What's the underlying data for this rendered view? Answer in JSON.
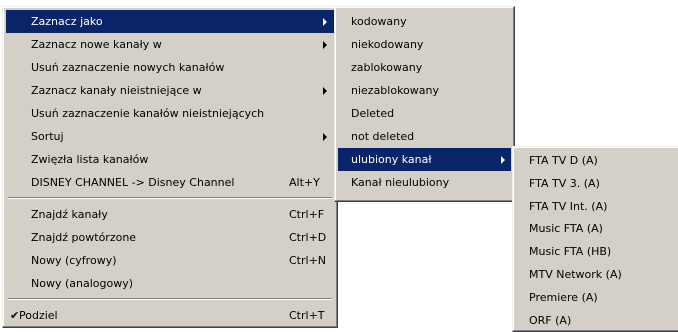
{
  "menu_main": {
    "items": [
      {
        "label": "Zaznacz jako",
        "shortcut": "",
        "submenu": true,
        "highlighted": true
      },
      {
        "label": "Zaznacz nowe kanały w",
        "shortcut": "",
        "submenu": true
      },
      {
        "label": "Usuń zaznaczenie nowych kanałów",
        "shortcut": "",
        "submenu": false
      },
      {
        "label": "Zaznacz kanały nieistniejące w",
        "shortcut": "",
        "submenu": true
      },
      {
        "label": "Usuń zaznaczenie kanałów nieistniejących",
        "shortcut": "",
        "submenu": false
      },
      {
        "label": "Sortuj",
        "shortcut": "",
        "submenu": true
      },
      {
        "label": "Zwięzła lista kanałów",
        "shortcut": "",
        "submenu": false
      },
      {
        "label": "DISNEY CHANNEL -> Disney Channel",
        "shortcut": "Alt+Y",
        "submenu": false
      },
      {
        "label": "Znajdź kanały",
        "shortcut": "Ctrl+F",
        "submenu": false
      },
      {
        "label": "Znajdź powtórzone",
        "shortcut": "Ctrl+D",
        "submenu": false
      },
      {
        "label": "Nowy (cyfrowy)",
        "shortcut": "Ctrl+N",
        "submenu": false
      },
      {
        "label": "Nowy (analogowy)",
        "shortcut": "",
        "submenu": false
      },
      {
        "label": "Podziel",
        "shortcut": "Ctrl+T",
        "submenu": false,
        "checked": true,
        "check_glyph": "✔"
      }
    ]
  },
  "menu_mark_as": {
    "items": [
      {
        "label": "kodowany"
      },
      {
        "label": "niekodowany"
      },
      {
        "label": "zablokowany"
      },
      {
        "label": "niezablokowany"
      },
      {
        "label": "Deleted"
      },
      {
        "label": "not deleted"
      },
      {
        "label": "ulubiony kanał",
        "submenu": true,
        "highlighted": true
      },
      {
        "label": "Kanał nieulubiony"
      }
    ]
  },
  "menu_favorites": {
    "items": [
      {
        "label": "FTA TV D (A)"
      },
      {
        "label": "FTA TV 3. (A)"
      },
      {
        "label": "FTA TV Int. (A)"
      },
      {
        "label": "Music FTA (A)"
      },
      {
        "label": "Music FTA (HB)"
      },
      {
        "label": "MTV Network (A)"
      },
      {
        "label": "Premiere (A)"
      },
      {
        "label": "ORF (A)"
      }
    ]
  },
  "colors": {
    "menu_bg": "#d4d0c8",
    "highlight_bg": "#0a246a",
    "highlight_text": "#ffffff"
  }
}
